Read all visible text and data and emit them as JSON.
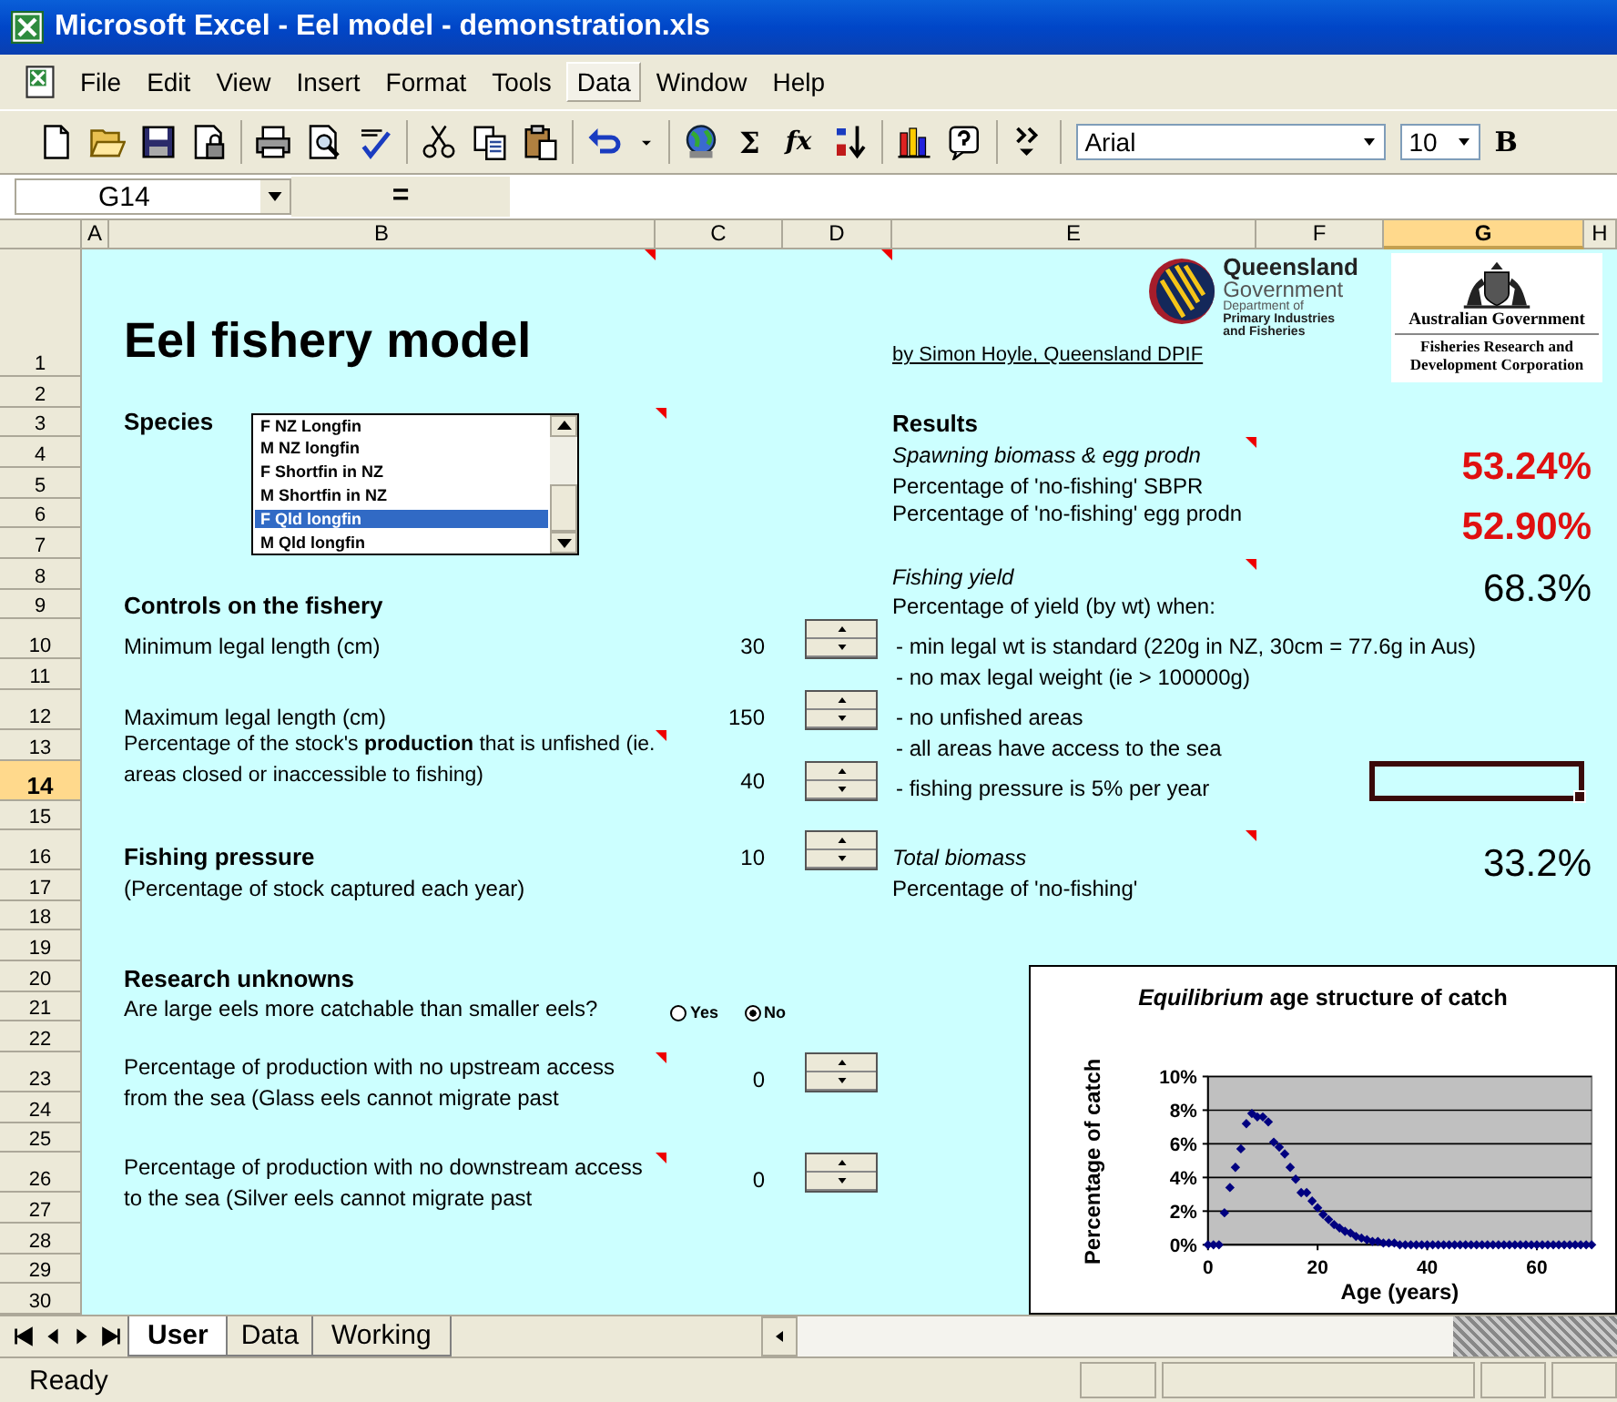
{
  "window": {
    "title": "Microsoft Excel - Eel model - demonstration.xls"
  },
  "menu": [
    {
      "label": "File",
      "hot": false
    },
    {
      "label": "Edit",
      "hot": false
    },
    {
      "label": "View",
      "hot": false
    },
    {
      "label": "Insert",
      "hot": false
    },
    {
      "label": "Format",
      "hot": false
    },
    {
      "label": "Tools",
      "hot": false
    },
    {
      "label": "Data",
      "hot": true
    },
    {
      "label": "Window",
      "hot": false
    },
    {
      "label": "Help",
      "hot": false
    }
  ],
  "toolbar": {
    "groups": [
      [
        {
          "kind": "new"
        },
        {
          "kind": "open"
        },
        {
          "kind": "save"
        },
        {
          "kind": "permission"
        }
      ],
      [
        {
          "kind": "print"
        },
        {
          "kind": "preview"
        },
        {
          "kind": "spelling"
        }
      ],
      [
        {
          "kind": "cut"
        },
        {
          "kind": "copy"
        },
        {
          "kind": "paste"
        }
      ],
      [
        {
          "kind": "undo"
        },
        {
          "kind": "dropdown"
        }
      ],
      [
        {
          "kind": "globe"
        },
        {
          "kind": "text",
          "label": "Σ"
        },
        {
          "kind": "text",
          "label": "fx"
        },
        {
          "kind": "sort"
        }
      ],
      [
        {
          "kind": "chart"
        },
        {
          "kind": "help"
        }
      ],
      [
        {
          "kind": "more"
        }
      ]
    ],
    "font": "Arial",
    "size": "10",
    "bold": "B"
  },
  "formula_bar": {
    "name_box": "G14",
    "equals": "="
  },
  "columns": [
    {
      "label": "A",
      "selected": false
    },
    {
      "label": "B",
      "selected": false
    },
    {
      "label": "C",
      "selected": false
    },
    {
      "label": "D",
      "selected": false
    },
    {
      "label": "E",
      "selected": false
    },
    {
      "label": "F",
      "selected": false
    },
    {
      "label": "G",
      "selected": true
    },
    {
      "label": "H",
      "selected": false
    }
  ],
  "rows": [
    {
      "label": "1",
      "selected": false
    },
    {
      "label": "2",
      "selected": false
    },
    {
      "label": "3",
      "selected": false
    },
    {
      "label": "4",
      "selected": false
    },
    {
      "label": "5",
      "selected": false
    },
    {
      "label": "6",
      "selected": false
    },
    {
      "label": "7",
      "selected": false
    },
    {
      "label": "8",
      "selected": false
    },
    {
      "label": "9",
      "selected": false
    },
    {
      "label": "10",
      "selected": false
    },
    {
      "label": "11",
      "selected": false
    },
    {
      "label": "12",
      "selected": false
    },
    {
      "label": "13",
      "selected": false
    },
    {
      "label": "14",
      "selected": true
    },
    {
      "label": "15",
      "selected": false
    },
    {
      "label": "16",
      "selected": false
    },
    {
      "label": "17",
      "selected": false
    },
    {
      "label": "18",
      "selected": false
    },
    {
      "label": "19",
      "selected": false
    },
    {
      "label": "20",
      "selected": false
    },
    {
      "label": "21",
      "selected": false
    },
    {
      "label": "22",
      "selected": false
    },
    {
      "label": "23",
      "selected": false
    },
    {
      "label": "24",
      "selected": false
    },
    {
      "label": "25",
      "selected": false
    },
    {
      "label": "26",
      "selected": false
    },
    {
      "label": "27",
      "selected": false
    },
    {
      "label": "28",
      "selected": false
    },
    {
      "label": "29",
      "selected": false
    },
    {
      "label": "30",
      "selected": false
    }
  ],
  "sheet": {
    "title": "Eel fishery model",
    "author": "by Simon Hoyle, Queensland DPIF",
    "qld_logo": {
      "name": "Queensland",
      "sub": "Government",
      "lines": [
        "Department of",
        "Primary Industries",
        "and Fisheries"
      ]
    },
    "aus_logo": {
      "name": "Australian Government",
      "lines": [
        "Fisheries Research and",
        "Development Corporation"
      ]
    },
    "species": {
      "label": "Species",
      "options": [
        {
          "label": "F NZ Longfin",
          "selected": false
        },
        {
          "label": "M NZ longfin",
          "selected": false
        },
        {
          "label": "F Shortfin in NZ",
          "selected": false
        },
        {
          "label": "M Shortfin in NZ",
          "selected": false
        },
        {
          "label": "F Qld longfin",
          "selected": true
        },
        {
          "label": "M Qld longfin",
          "selected": false
        }
      ]
    },
    "results": {
      "heading": "Results",
      "spawning": "Spawning biomass & egg prodn",
      "sbpr_label": "Percentage of 'no-fishing' SBPR",
      "sbpr": "53.24%",
      "egg_label": "Percentage of 'no-fishing' egg prodn",
      "egg": "52.90%",
      "yield_heading": "Fishing yield",
      "yield_label": "Percentage of yield (by wt) when:",
      "yield": "68.3%",
      "conditions": [
        "- min legal wt is standard (220g in NZ, 30cm = 77.6g in Aus)",
        "- no max legal weight (ie > 100000g)",
        "- no unfished areas",
        "- all areas have access to the sea",
        "- fishing pressure is 5% per year"
      ],
      "biomass_heading": "Total biomass",
      "biomass_label": "Percentage of 'no-fishing'",
      "biomass": "33.2%"
    },
    "controls": {
      "heading": "Controls on the fishery",
      "min_length": {
        "label": "Minimum legal length (cm)",
        "value": "30"
      },
      "max_length": {
        "label": "Maximum legal length (cm)",
        "value": "150"
      },
      "unfished": {
        "label": "Percentage of the stock's **production** that is unfished (ie. areas closed or inaccessible to fishing)",
        "value": "40"
      },
      "pressure": {
        "label": "Fishing pressure",
        "note": "(Percentage of stock captured each year)",
        "value": "10"
      }
    },
    "research": {
      "heading": "Research unknowns",
      "question": "Are large eels more catchable than smaller eels?",
      "options": [
        {
          "label": "Yes",
          "selected": false
        },
        {
          "label": "No",
          "selected": true
        }
      ],
      "upstream": {
        "label": "Percentage of production with no upstream access from the sea (Glass eels cannot migrate past",
        "value": "0"
      },
      "downstream": {
        "label": "Percentage of production with no downstream access to the sea (Silver eels cannot migrate past",
        "value": "0"
      }
    },
    "chart_data": {
      "type": "scatter",
      "title": "*Equilibrium* age structure of catch",
      "xlabel": "Age (years)",
      "ylabel": "Percentage of catch",
      "x": [
        0,
        1,
        2,
        3,
        4,
        5,
        6,
        7,
        8,
        9,
        10,
        11,
        12,
        13,
        14,
        15,
        16,
        17,
        18,
        19,
        20,
        21,
        22,
        23,
        24,
        25,
        26,
        27,
        28,
        29,
        30,
        31,
        32,
        33,
        34,
        35,
        36,
        37,
        38,
        39,
        40,
        41,
        42,
        43,
        44,
        45,
        46,
        47,
        48,
        49,
        50,
        51,
        52,
        53,
        54,
        55,
        56,
        57,
        58,
        59,
        60,
        61,
        62,
        63,
        64,
        65,
        66,
        67,
        68,
        69,
        70
      ],
      "grid": true,
      "series": [
        {
          "color": "#000080",
          "values": [
            0,
            0,
            0,
            1.9,
            3.4,
            4.6,
            5.7,
            7.2,
            7.8,
            7.6,
            7.6,
            7.3,
            6.1,
            5.8,
            5.4,
            4.6,
            3.9,
            3.1,
            3.1,
            2.6,
            2.2,
            1.8,
            1.5,
            1.2,
            1.0,
            0.8,
            0.7,
            0.5,
            0.4,
            0.3,
            0.2,
            0.2,
            0.1,
            0.1,
            0.1,
            0,
            0,
            0,
            0,
            0,
            0,
            0,
            0,
            0,
            0,
            0,
            0,
            0,
            0,
            0,
            0,
            0,
            0,
            0,
            0,
            0,
            0,
            0,
            0,
            0,
            0,
            0,
            0,
            0,
            0,
            0,
            0,
            0,
            0,
            0,
            0
          ]
        }
      ],
      "xlim": [
        0,
        70
      ],
      "ylim": [
        0,
        10
      ],
      "xticks": [
        0,
        20,
        40,
        60
      ],
      "yticks": [
        {
          "value": 0,
          "label": "0%"
        },
        {
          "value": 2,
          "label": "2%"
        },
        {
          "value": 4,
          "label": "4%"
        },
        {
          "value": 6,
          "label": "6%"
        },
        {
          "value": 8,
          "label": "8%"
        },
        {
          "value": 10,
          "label": "10%"
        }
      ]
    }
  },
  "tabs": [
    {
      "label": "User",
      "selected": true
    },
    {
      "label": "Data",
      "selected": false
    },
    {
      "label": "Working",
      "selected": false
    }
  ],
  "status_bar": {
    "text": "Ready"
  }
}
